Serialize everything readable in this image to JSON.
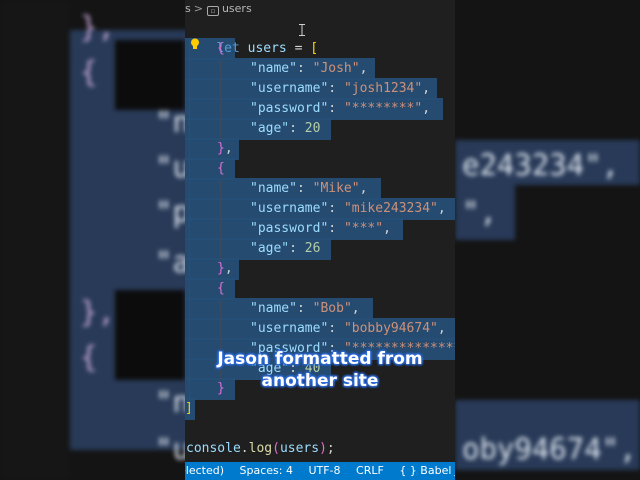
{
  "breadcrumb": {
    "file": "s",
    "symbol": "users"
  },
  "code": {
    "line1": {
      "kw": "let",
      "name": "users",
      "op": "=",
      "open": "["
    },
    "objects": [
      {
        "name": "Josh",
        "username": "josh1234",
        "password": "********",
        "age": "20"
      },
      {
        "name": "Mike",
        "username": "mike243234",
        "password": "***",
        "age": "26"
      },
      {
        "name": "Bob",
        "username": "bobby94674",
        "password": "**************",
        "age": "40"
      }
    ],
    "keys": {
      "name": "\"name\"",
      "username": "\"username\"",
      "password": "\"password\"",
      "age": "\"age\""
    },
    "close": "]",
    "console": {
      "obj": "console",
      "method": "log",
      "arg": "users",
      "tail": ");"
    }
  },
  "caption": {
    "line1": "Jason formatted from",
    "line2": "another site"
  },
  "status_bar": {
    "selected": "elected)",
    "spaces": "Spaces: 4",
    "encoding": "UTF-8",
    "eol": "CRLF",
    "language": "{ }  Babel JavaSc"
  },
  "background_text": {
    "b1": "},",
    "b2": "{",
    "b3": "\"n",
    "b4": "\"u",
    "b5": "\"p",
    "b6": "\"a",
    "b7": "e243234\",",
    "b8": "\",",
    "b9": "},",
    "b10": "{",
    "b11": "\"n",
    "b12": "\"u",
    "b13": "oby94674\","
  }
}
